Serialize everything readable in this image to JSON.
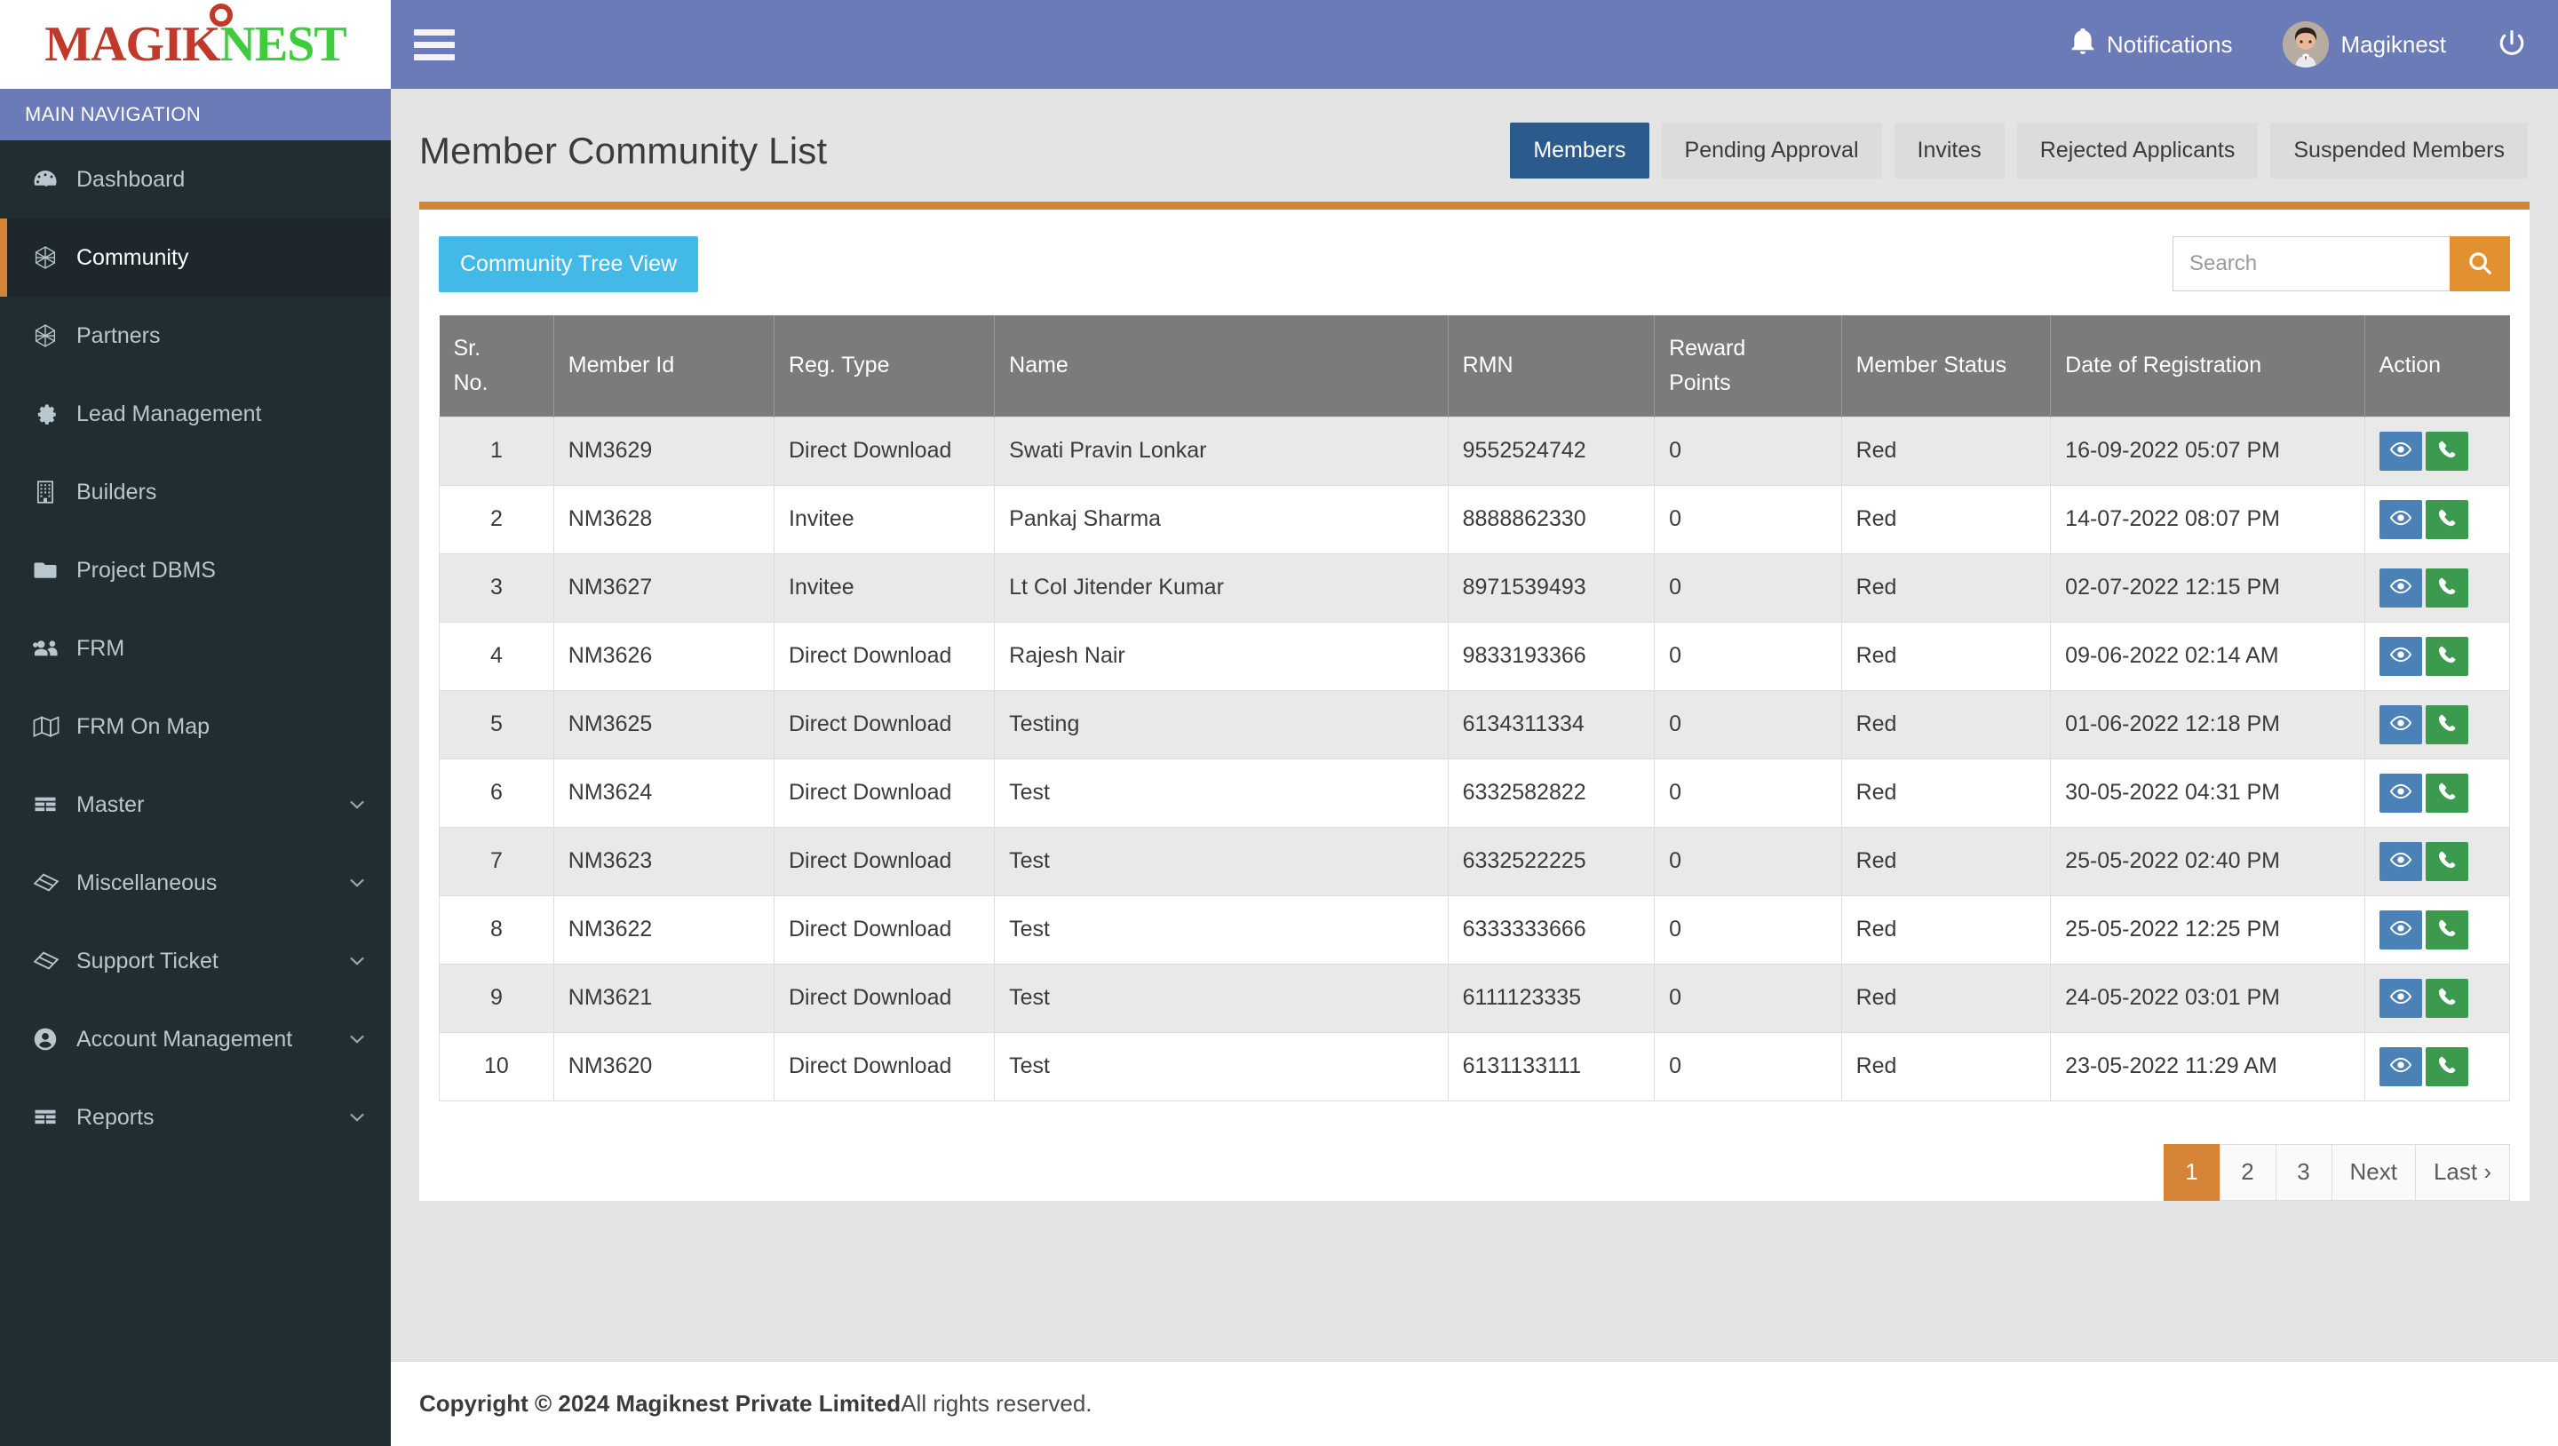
{
  "brand": {
    "logo_magik": "MAGIK",
    "logo_nest": "NEST",
    "accent_orange": "#d58435",
    "header_blue": "#6a7bb8",
    "sidebar_dark": "#222d32"
  },
  "sidebar": {
    "nav_header": "MAIN NAVIGATION",
    "items": [
      {
        "label": "Dashboard",
        "icon": "dashboard-icon",
        "active": false,
        "caret": false
      },
      {
        "label": "Community",
        "icon": "community-icon",
        "active": true,
        "caret": false
      },
      {
        "label": "Partners",
        "icon": "partners-icon",
        "active": false,
        "caret": false
      },
      {
        "label": "Lead Management",
        "icon": "gear-icon",
        "active": false,
        "caret": false
      },
      {
        "label": "Builders",
        "icon": "building-icon",
        "active": false,
        "caret": false
      },
      {
        "label": "Project DBMS",
        "icon": "folder-icon",
        "active": false,
        "caret": false
      },
      {
        "label": "FRM",
        "icon": "users-icon",
        "active": false,
        "caret": false
      },
      {
        "label": "FRM On Map",
        "icon": "map-icon",
        "active": false,
        "caret": false
      },
      {
        "label": "Master",
        "icon": "table-icon",
        "active": false,
        "caret": true
      },
      {
        "label": "Miscellaneous",
        "icon": "ticket-icon",
        "active": false,
        "caret": true
      },
      {
        "label": "Support Ticket",
        "icon": "ticket-icon",
        "active": false,
        "caret": true
      },
      {
        "label": "Account Management",
        "icon": "user-circle-icon",
        "active": false,
        "caret": true
      },
      {
        "label": "Reports",
        "icon": "table-icon",
        "active": false,
        "caret": true
      }
    ]
  },
  "topbar": {
    "menu_toggle": "hamburger-icon",
    "notifications_label": "Notifications",
    "notifications_icon": "bell-icon",
    "user_name": "Magiknest",
    "logout_icon": "power-icon"
  },
  "page": {
    "title": "Member Community List",
    "tabs": [
      {
        "label": "Members",
        "active": true
      },
      {
        "label": "Pending Approval",
        "active": false
      },
      {
        "label": "Invites",
        "active": false
      },
      {
        "label": "Rejected Applicants",
        "active": false
      },
      {
        "label": "Suspended Members",
        "active": false
      }
    ]
  },
  "toolbar": {
    "tree_view_label": "Community Tree View",
    "search_value": "",
    "search_placeholder": "Search",
    "search_icon": "search-icon"
  },
  "table": {
    "columns": [
      "Sr. No.",
      "Member Id",
      "Reg. Type",
      "Name",
      "RMN",
      "Reward Points",
      "Member Status",
      "Date of Registration",
      "Action"
    ],
    "columns_display": {
      "sr_line1": "Sr.",
      "sr_line2": "No.",
      "member_id": "Member Id",
      "reg_type": "Reg. Type",
      "name": "Name",
      "rmn": "RMN",
      "reward_line1": "Reward",
      "reward_line2": "Points",
      "member_status": "Member Status",
      "date_of_registration": "Date of Registration",
      "action": "Action"
    },
    "action_icons": {
      "view": "eye-icon",
      "call": "phone-icon"
    },
    "rows": [
      {
        "sr": "1",
        "member_id": "NM3629",
        "reg_type": "Direct Download",
        "name": "Swati Pravin Lonkar",
        "rmn": "9552524742",
        "reward_points": "0",
        "status": "Red",
        "date": "16-09-2022 05:07 PM"
      },
      {
        "sr": "2",
        "member_id": "NM3628",
        "reg_type": "Invitee",
        "name": "Pankaj Sharma",
        "rmn": "8888862330",
        "reward_points": "0",
        "status": "Red",
        "date": "14-07-2022 08:07 PM"
      },
      {
        "sr": "3",
        "member_id": "NM3627",
        "reg_type": "Invitee",
        "name": "Lt Col Jitender Kumar",
        "rmn": "8971539493",
        "reward_points": "0",
        "status": "Red",
        "date": "02-07-2022 12:15 PM"
      },
      {
        "sr": "4",
        "member_id": "NM3626",
        "reg_type": "Direct Download",
        "name": "Rajesh Nair",
        "rmn": "9833193366",
        "reward_points": "0",
        "status": "Red",
        "date": "09-06-2022 02:14 AM"
      },
      {
        "sr": "5",
        "member_id": "NM3625",
        "reg_type": "Direct Download",
        "name": "Testing",
        "rmn": "6134311334",
        "reward_points": "0",
        "status": "Red",
        "date": "01-06-2022 12:18 PM"
      },
      {
        "sr": "6",
        "member_id": "NM3624",
        "reg_type": "Direct Download",
        "name": "Test",
        "rmn": "6332582822",
        "reward_points": "0",
        "status": "Red",
        "date": "30-05-2022 04:31 PM"
      },
      {
        "sr": "7",
        "member_id": "NM3623",
        "reg_type": "Direct Download",
        "name": "Test",
        "rmn": "6332522225",
        "reward_points": "0",
        "status": "Red",
        "date": "25-05-2022 02:40 PM"
      },
      {
        "sr": "8",
        "member_id": "NM3622",
        "reg_type": "Direct Download",
        "name": "Test",
        "rmn": "6333333666",
        "reward_points": "0",
        "status": "Red",
        "date": "25-05-2022 12:25 PM"
      },
      {
        "sr": "9",
        "member_id": "NM3621",
        "reg_type": "Direct Download",
        "name": "Test",
        "rmn": "6111123335",
        "reward_points": "0",
        "status": "Red",
        "date": "24-05-2022 03:01 PM"
      },
      {
        "sr": "10",
        "member_id": "NM3620",
        "reg_type": "Direct Download",
        "name": "Test",
        "rmn": "6131133111",
        "reward_points": "0",
        "status": "Red",
        "date": "23-05-2022 11:29 AM"
      }
    ]
  },
  "pagination": {
    "pages": [
      {
        "label": "1",
        "active": true
      },
      {
        "label": "2",
        "active": false
      },
      {
        "label": "3",
        "active": false
      },
      {
        "label": "Next",
        "active": false
      },
      {
        "label": "Last ›",
        "active": false
      }
    ]
  },
  "footer": {
    "copyright_bold": "Copyright © 2024 Magiknest Private Limited",
    "rights": " All rights reserved."
  }
}
